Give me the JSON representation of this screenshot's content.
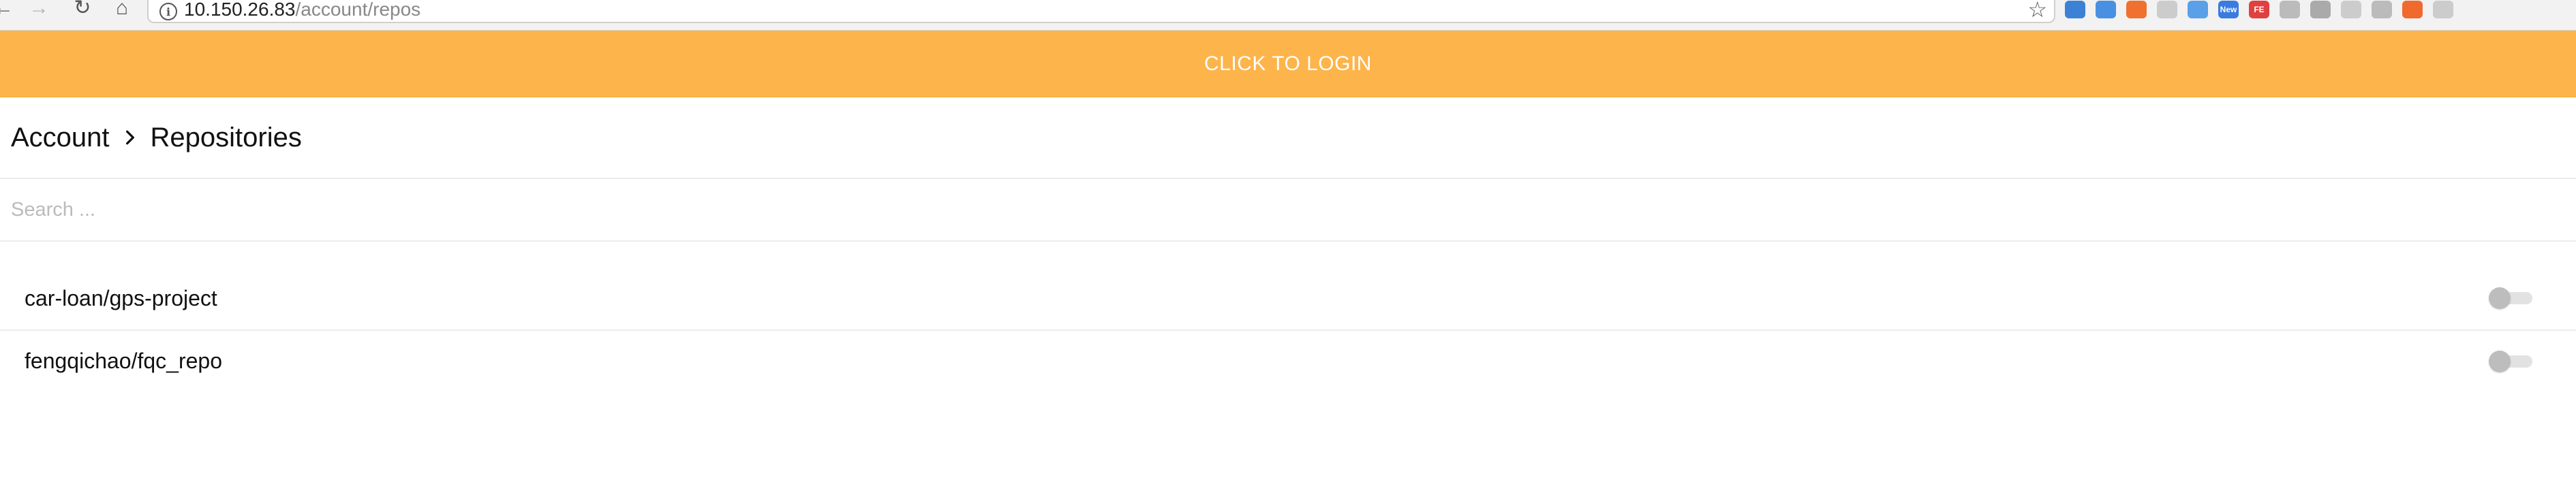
{
  "browser": {
    "url_host": "10.150.26.83",
    "url_path": "/account/repos",
    "back_glyph": "←",
    "forward_glyph": "→",
    "reload_glyph": "↻",
    "home_glyph": "⌂",
    "info_glyph": "i",
    "star_glyph": "☆",
    "extensions": [
      {
        "icon": "ext-blue-icon",
        "label": "",
        "color": "#3b82d6"
      },
      {
        "icon": "ext-translate-icon",
        "label": "",
        "color": "#4a90e2"
      },
      {
        "icon": "ext-orange-icon",
        "label": "",
        "color": "#f07030"
      },
      {
        "icon": "ext-gray-icon",
        "label": "",
        "color": "#cccccc"
      },
      {
        "icon": "ext-feather-icon",
        "label": "",
        "color": "#5aa0e8"
      },
      {
        "icon": "ext-new-icon",
        "label": "New",
        "color": "#3a7be0"
      },
      {
        "icon": "ext-fe-icon",
        "label": "FE",
        "color": "#e04040"
      },
      {
        "icon": "ext-bird-icon",
        "label": "",
        "color": "#bbbbbb"
      },
      {
        "icon": "ext-funnel-icon",
        "label": "",
        "color": "#aaaaaa"
      },
      {
        "icon": "ext-gear-icon",
        "label": "",
        "color": "#cccccc"
      },
      {
        "icon": "ext-qr-icon",
        "label": "",
        "color": "#bbbbbb"
      },
      {
        "icon": "ext-gitlab-icon",
        "label": "",
        "color": "#f06a2e"
      },
      {
        "icon": "ext-circle-icon",
        "label": "",
        "color": "#cccccc"
      }
    ]
  },
  "banner": {
    "label": "CLICK TO LOGIN",
    "color": "#fdb44a"
  },
  "breadcrumb": {
    "account": "Account",
    "current": "Repositories"
  },
  "search": {
    "placeholder": "Search ...",
    "value": ""
  },
  "repos": [
    {
      "name": "car-loan/gps-project",
      "enabled": false
    },
    {
      "name": "fengqichao/fqc_repo",
      "enabled": false
    }
  ]
}
